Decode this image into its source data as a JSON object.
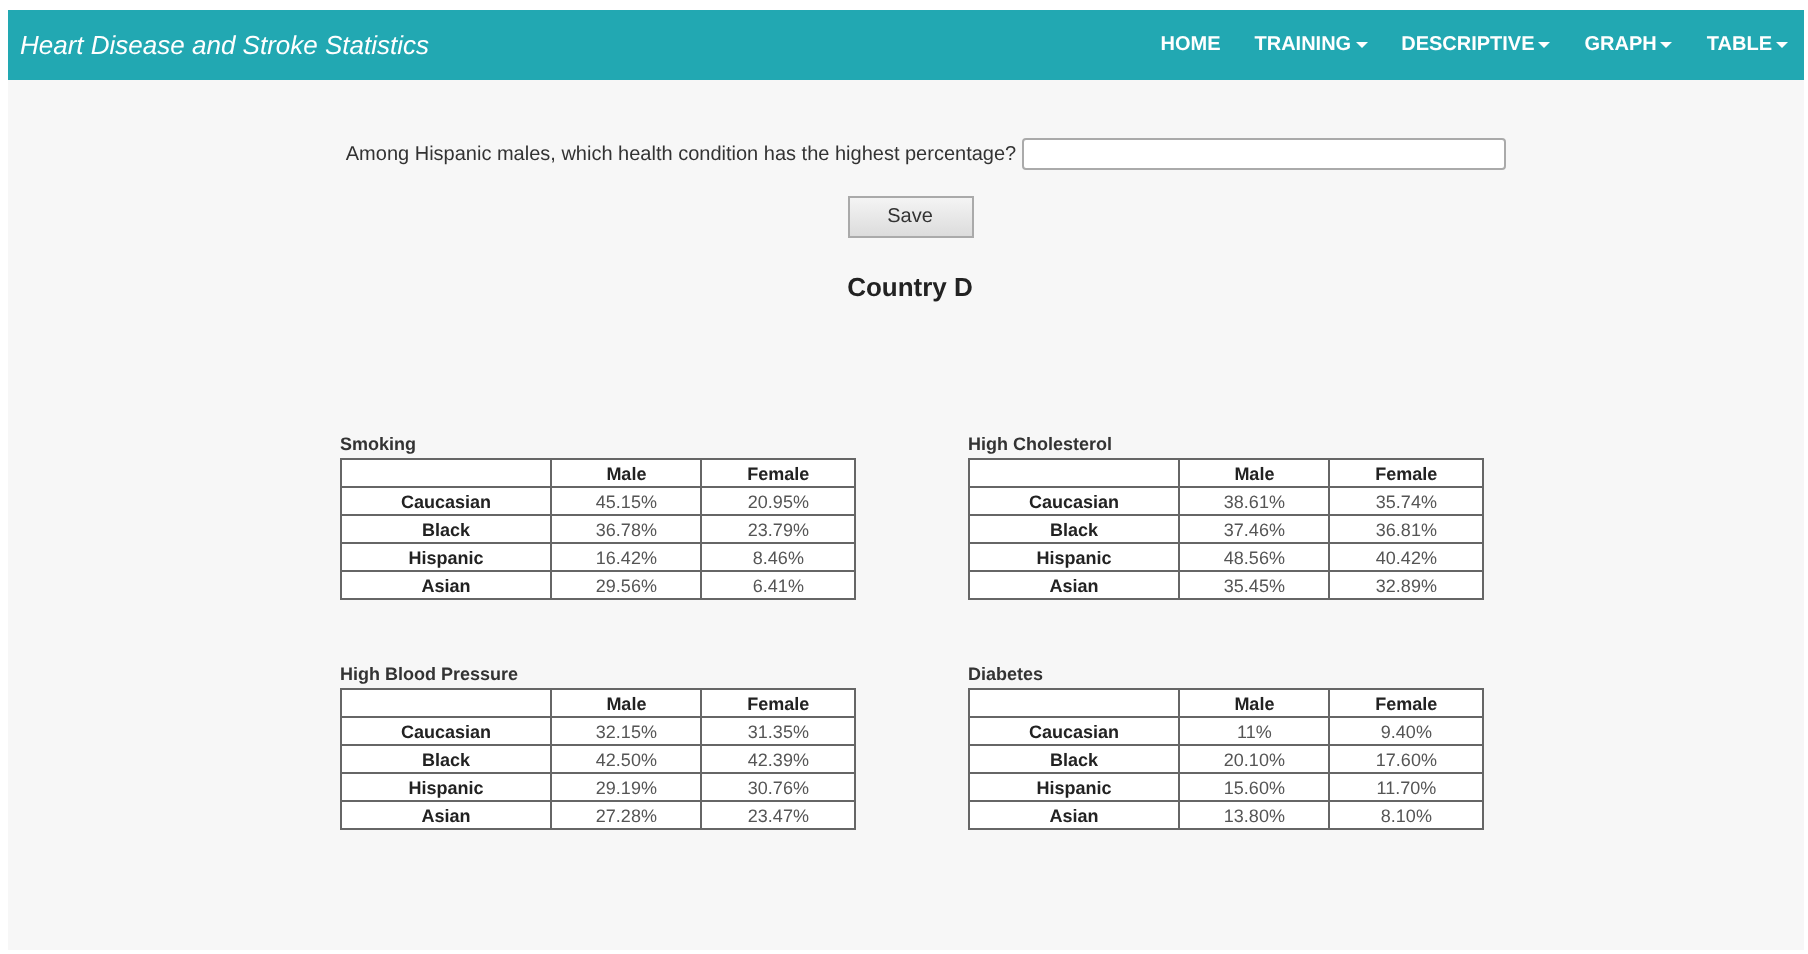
{
  "navbar": {
    "brand": "Heart Disease and Stroke Statistics",
    "items": [
      {
        "label": "HOME",
        "has_menu": false
      },
      {
        "label": "TRAINING",
        "has_menu": true
      },
      {
        "label": "DESCRIPTIVE",
        "has_menu": true
      },
      {
        "label": "GRAPH",
        "has_menu": true
      },
      {
        "label": "TABLE",
        "has_menu": true
      }
    ]
  },
  "question": {
    "label": "Among Hispanic males, which health condition has the highest percentage?"
  },
  "save_button": "Save",
  "heading": "Country D",
  "tables": [
    {
      "title": "Smoking",
      "columns": [
        "Male",
        "Female"
      ],
      "rows": [
        {
          "group": "Caucasian",
          "values": [
            "45.15%",
            "20.95%"
          ]
        },
        {
          "group": "Black",
          "values": [
            "36.78%",
            "23.79%"
          ]
        },
        {
          "group": "Hispanic",
          "values": [
            "16.42%",
            "8.46%"
          ]
        },
        {
          "group": "Asian",
          "values": [
            "29.56%",
            "6.41%"
          ]
        }
      ]
    },
    {
      "title": "High Cholesterol",
      "columns": [
        "Male",
        "Female"
      ],
      "rows": [
        {
          "group": "Caucasian",
          "values": [
            "38.61%",
            "35.74%"
          ]
        },
        {
          "group": "Black",
          "values": [
            "37.46%",
            "36.81%"
          ]
        },
        {
          "group": "Hispanic",
          "values": [
            "48.56%",
            "40.42%"
          ]
        },
        {
          "group": "Asian",
          "values": [
            "35.45%",
            "32.89%"
          ]
        }
      ]
    },
    {
      "title": "High Blood Pressure",
      "columns": [
        "Male",
        "Female"
      ],
      "rows": [
        {
          "group": "Caucasian",
          "values": [
            "32.15%",
            "31.35%"
          ]
        },
        {
          "group": "Black",
          "values": [
            "42.50%",
            "42.39%"
          ]
        },
        {
          "group": "Hispanic",
          "values": [
            "29.19%",
            "30.76%"
          ]
        },
        {
          "group": "Asian",
          "values": [
            "27.28%",
            "23.47%"
          ]
        }
      ]
    },
    {
      "title": "Diabetes",
      "columns": [
        "Male",
        "Female"
      ],
      "rows": [
        {
          "group": "Caucasian",
          "values": [
            "11%",
            "9.40%"
          ]
        },
        {
          "group": "Black",
          "values": [
            "20.10%",
            "17.60%"
          ]
        },
        {
          "group": "Hispanic",
          "values": [
            "15.60%",
            "11.70%"
          ]
        },
        {
          "group": "Asian",
          "values": [
            "13.80%",
            "8.10%"
          ]
        }
      ]
    }
  ]
}
